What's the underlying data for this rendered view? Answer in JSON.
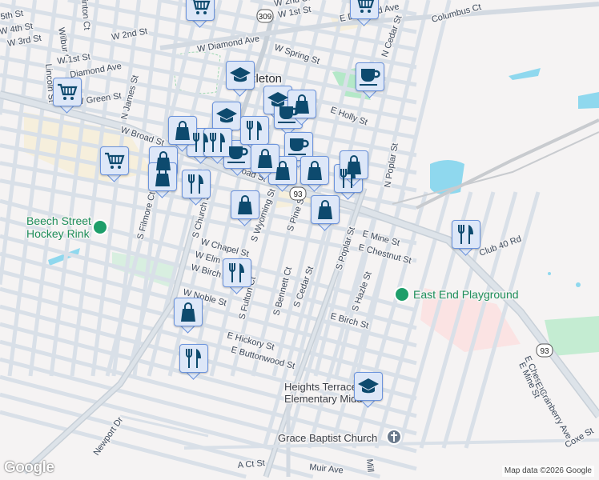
{
  "map": {
    "city_label": "zleton",
    "streets": [
      "W 5th St",
      "W 4th St",
      "W 3rd St",
      "Wilbur Ct",
      "inton Ct",
      "W 2nd St",
      "W 1st St",
      "Diamond Ave",
      "Lincoln St",
      "W Green St",
      "N James St",
      "W Broad St",
      "W Diamond Ave",
      "W Spring St",
      "W 2nd St",
      "W 1st St",
      "E Diamond Ave",
      "Columbus Ct",
      "N Cedar St",
      "E Holly St",
      "S Filmore Ct",
      "S Church St",
      "W Chapel St",
      "W Elm St",
      "W Birch St",
      "W Noble St",
      "S Wyoming St",
      "S Pine St",
      "S Bennett Ct",
      "S Cedar St",
      "S Poplar St",
      "E Mine St",
      "E Chestnut St",
      "S Hazle St",
      "S Fulton Ct",
      "E Birch St",
      "E Hickory St",
      "E Buttonwood St",
      "Club 40 Rd",
      "Newport Dr",
      "A Ct St",
      "Muir Ave",
      "E Mine St",
      "E Chestnut St",
      "E Cranberry Ave",
      "Coxe St",
      "Mill",
      "N Poplar St",
      "W Broad St"
    ],
    "pois": {
      "hockey_line1": "Beech Street",
      "hockey_line2": "Hockey Rink",
      "playground": "East End Playground",
      "school_line1": "Heights Terrace",
      "school_line2": "Elementary Middle",
      "church": "Grace Baptist Church"
    },
    "shields": [
      "309",
      "93",
      "93"
    ],
    "markers": [
      "cart",
      "cart",
      "cart",
      "cart",
      "cap",
      "cap",
      "cap",
      "cup",
      "cup",
      "cup",
      "cup",
      "fork",
      "fork",
      "fork",
      "fork",
      "fork",
      "fork",
      "fork",
      "bag",
      "bag",
      "bag",
      "bag",
      "bag",
      "bag",
      "bag",
      "bag",
      "bag",
      "bag",
      "bag",
      "fork",
      "cap"
    ],
    "colors": {
      "marker_bg": "#dde7f8",
      "marker_border": "#6b93dc",
      "icon": "#0d4a6e",
      "water": "#8fd8ee",
      "park": "#b4e8c8"
    }
  },
  "footer": {
    "attribution": "Map data ©2026 Google",
    "logo": "Google"
  }
}
